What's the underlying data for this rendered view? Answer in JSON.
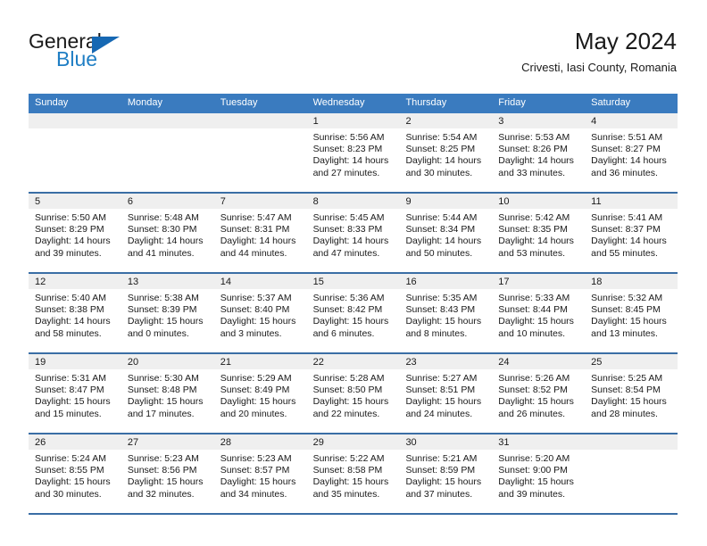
{
  "brand": {
    "name_part1": "General",
    "name_part2": "Blue",
    "triangle_color": "#1668b3",
    "blue_text_color": "#1f7ec4"
  },
  "header": {
    "title": "May 2024",
    "subtitle": "Crivesti, Iasi County, Romania"
  },
  "theme": {
    "header_blue": "#3a7bbf",
    "row_divider_blue": "#3a6ea5",
    "day_band_gray": "#efefef"
  },
  "weekdays": [
    "Sunday",
    "Monday",
    "Tuesday",
    "Wednesday",
    "Thursday",
    "Friday",
    "Saturday"
  ],
  "weeks": [
    [
      {
        "day": "",
        "empty": true
      },
      {
        "day": "",
        "empty": true
      },
      {
        "day": "",
        "empty": true
      },
      {
        "day": "1",
        "sunrise": "Sunrise: 5:56 AM",
        "sunset": "Sunset: 8:23 PM",
        "daylight1": "Daylight: 14 hours",
        "daylight2": "and 27 minutes."
      },
      {
        "day": "2",
        "sunrise": "Sunrise: 5:54 AM",
        "sunset": "Sunset: 8:25 PM",
        "daylight1": "Daylight: 14 hours",
        "daylight2": "and 30 minutes."
      },
      {
        "day": "3",
        "sunrise": "Sunrise: 5:53 AM",
        "sunset": "Sunset: 8:26 PM",
        "daylight1": "Daylight: 14 hours",
        "daylight2": "and 33 minutes."
      },
      {
        "day": "4",
        "sunrise": "Sunrise: 5:51 AM",
        "sunset": "Sunset: 8:27 PM",
        "daylight1": "Daylight: 14 hours",
        "daylight2": "and 36 minutes."
      }
    ],
    [
      {
        "day": "5",
        "sunrise": "Sunrise: 5:50 AM",
        "sunset": "Sunset: 8:29 PM",
        "daylight1": "Daylight: 14 hours",
        "daylight2": "and 39 minutes."
      },
      {
        "day": "6",
        "sunrise": "Sunrise: 5:48 AM",
        "sunset": "Sunset: 8:30 PM",
        "daylight1": "Daylight: 14 hours",
        "daylight2": "and 41 minutes."
      },
      {
        "day": "7",
        "sunrise": "Sunrise: 5:47 AM",
        "sunset": "Sunset: 8:31 PM",
        "daylight1": "Daylight: 14 hours",
        "daylight2": "and 44 minutes."
      },
      {
        "day": "8",
        "sunrise": "Sunrise: 5:45 AM",
        "sunset": "Sunset: 8:33 PM",
        "daylight1": "Daylight: 14 hours",
        "daylight2": "and 47 minutes."
      },
      {
        "day": "9",
        "sunrise": "Sunrise: 5:44 AM",
        "sunset": "Sunset: 8:34 PM",
        "daylight1": "Daylight: 14 hours",
        "daylight2": "and 50 minutes."
      },
      {
        "day": "10",
        "sunrise": "Sunrise: 5:42 AM",
        "sunset": "Sunset: 8:35 PM",
        "daylight1": "Daylight: 14 hours",
        "daylight2": "and 53 minutes."
      },
      {
        "day": "11",
        "sunrise": "Sunrise: 5:41 AM",
        "sunset": "Sunset: 8:37 PM",
        "daylight1": "Daylight: 14 hours",
        "daylight2": "and 55 minutes."
      }
    ],
    [
      {
        "day": "12",
        "sunrise": "Sunrise: 5:40 AM",
        "sunset": "Sunset: 8:38 PM",
        "daylight1": "Daylight: 14 hours",
        "daylight2": "and 58 minutes."
      },
      {
        "day": "13",
        "sunrise": "Sunrise: 5:38 AM",
        "sunset": "Sunset: 8:39 PM",
        "daylight1": "Daylight: 15 hours",
        "daylight2": "and 0 minutes."
      },
      {
        "day": "14",
        "sunrise": "Sunrise: 5:37 AM",
        "sunset": "Sunset: 8:40 PM",
        "daylight1": "Daylight: 15 hours",
        "daylight2": "and 3 minutes."
      },
      {
        "day": "15",
        "sunrise": "Sunrise: 5:36 AM",
        "sunset": "Sunset: 8:42 PM",
        "daylight1": "Daylight: 15 hours",
        "daylight2": "and 6 minutes."
      },
      {
        "day": "16",
        "sunrise": "Sunrise: 5:35 AM",
        "sunset": "Sunset: 8:43 PM",
        "daylight1": "Daylight: 15 hours",
        "daylight2": "and 8 minutes."
      },
      {
        "day": "17",
        "sunrise": "Sunrise: 5:33 AM",
        "sunset": "Sunset: 8:44 PM",
        "daylight1": "Daylight: 15 hours",
        "daylight2": "and 10 minutes."
      },
      {
        "day": "18",
        "sunrise": "Sunrise: 5:32 AM",
        "sunset": "Sunset: 8:45 PM",
        "daylight1": "Daylight: 15 hours",
        "daylight2": "and 13 minutes."
      }
    ],
    [
      {
        "day": "19",
        "sunrise": "Sunrise: 5:31 AM",
        "sunset": "Sunset: 8:47 PM",
        "daylight1": "Daylight: 15 hours",
        "daylight2": "and 15 minutes."
      },
      {
        "day": "20",
        "sunrise": "Sunrise: 5:30 AM",
        "sunset": "Sunset: 8:48 PM",
        "daylight1": "Daylight: 15 hours",
        "daylight2": "and 17 minutes."
      },
      {
        "day": "21",
        "sunrise": "Sunrise: 5:29 AM",
        "sunset": "Sunset: 8:49 PM",
        "daylight1": "Daylight: 15 hours",
        "daylight2": "and 20 minutes."
      },
      {
        "day": "22",
        "sunrise": "Sunrise: 5:28 AM",
        "sunset": "Sunset: 8:50 PM",
        "daylight1": "Daylight: 15 hours",
        "daylight2": "and 22 minutes."
      },
      {
        "day": "23",
        "sunrise": "Sunrise: 5:27 AM",
        "sunset": "Sunset: 8:51 PM",
        "daylight1": "Daylight: 15 hours",
        "daylight2": "and 24 minutes."
      },
      {
        "day": "24",
        "sunrise": "Sunrise: 5:26 AM",
        "sunset": "Sunset: 8:52 PM",
        "daylight1": "Daylight: 15 hours",
        "daylight2": "and 26 minutes."
      },
      {
        "day": "25",
        "sunrise": "Sunrise: 5:25 AM",
        "sunset": "Sunset: 8:54 PM",
        "daylight1": "Daylight: 15 hours",
        "daylight2": "and 28 minutes."
      }
    ],
    [
      {
        "day": "26",
        "sunrise": "Sunrise: 5:24 AM",
        "sunset": "Sunset: 8:55 PM",
        "daylight1": "Daylight: 15 hours",
        "daylight2": "and 30 minutes."
      },
      {
        "day": "27",
        "sunrise": "Sunrise: 5:23 AM",
        "sunset": "Sunset: 8:56 PM",
        "daylight1": "Daylight: 15 hours",
        "daylight2": "and 32 minutes."
      },
      {
        "day": "28",
        "sunrise": "Sunrise: 5:23 AM",
        "sunset": "Sunset: 8:57 PM",
        "daylight1": "Daylight: 15 hours",
        "daylight2": "and 34 minutes."
      },
      {
        "day": "29",
        "sunrise": "Sunrise: 5:22 AM",
        "sunset": "Sunset: 8:58 PM",
        "daylight1": "Daylight: 15 hours",
        "daylight2": "and 35 minutes."
      },
      {
        "day": "30",
        "sunrise": "Sunrise: 5:21 AM",
        "sunset": "Sunset: 8:59 PM",
        "daylight1": "Daylight: 15 hours",
        "daylight2": "and 37 minutes."
      },
      {
        "day": "31",
        "sunrise": "Sunrise: 5:20 AM",
        "sunset": "Sunset: 9:00 PM",
        "daylight1": "Daylight: 15 hours",
        "daylight2": "and 39 minutes."
      },
      {
        "day": "",
        "empty": true
      }
    ]
  ]
}
